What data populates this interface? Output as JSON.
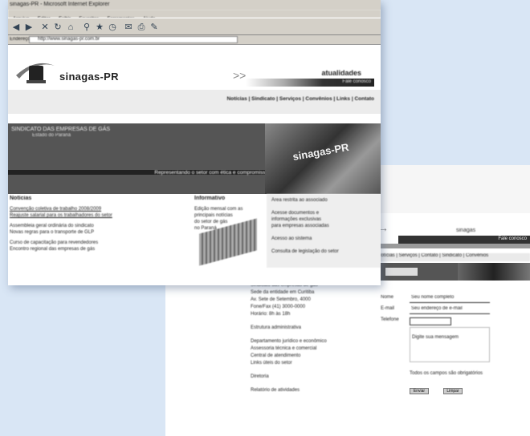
{
  "back": {
    "logo_text": "sinagas",
    "bar_text": "Fale conosco",
    "nav": "Notícias | Serviços | Contato | Sindicato | Convênios",
    "left_lines": [
      "Sindicato das empresas de gás",
      "Sede da entidade em Curitiba",
      "Av. Sete de Setembro, 4000",
      "Fone/Fax (41) 3000-0000",
      "Horário: 8h às 18h",
      "",
      "Estrutura administrativa",
      "",
      "Departamento jurídico e econômico",
      "Assessoria técnica e comercial",
      "Central de atendimento",
      "Links úteis do setor",
      "",
      "Diretoria",
      "",
      "Relatório de atividades"
    ],
    "form": {
      "name_label": "Nome",
      "name_value": "Seu nome completo",
      "email_label": "E-mail",
      "email_value": "Seu endereço de e-mail",
      "phone_label": "Telefone",
      "msg_value": "Digite sua mensagem",
      "submit": "Enviar",
      "clear": "Limpar",
      "note": "Todos os campos são obrigatórios"
    }
  },
  "front": {
    "window_title": "sinagas-PR - Microsoft Internet Explorer",
    "menu": [
      "Arquivo",
      "Editar",
      "Exibir",
      "Favoritos",
      "Ferramentas",
      "Ajuda"
    ],
    "address_label": "Endereço",
    "address_value": "http://www.sinagas-pr.com.br",
    "logo_text": "sinagas-PR",
    "header_title": "atualidades",
    "header_bar": "Fale conosco",
    "nav_links": "Notícias | Sindicato | Serviços | Convênios | Links | Contato",
    "banner_l1": "SINDICATO DAS EMPRESAS DE GÁS",
    "banner_l2": "Estado do Paraná",
    "banner_tagline": "Representando o setor com ética e compromisso",
    "banner_sign": "sinagas-PR",
    "news_title": "Notícias",
    "news": [
      "Convenção coletiva de trabalho 2008/2009",
      "Reajuste salarial para os trabalhadores do setor",
      "",
      "Assembleia geral ordinária do sindicato",
      "Novas regras para o transporte de GLP",
      "",
      "Curso de capacitação para revendedores",
      "Encontro regional das empresas de gás"
    ],
    "info_title": "Informativo",
    "info_lines": [
      "Edição mensal com as",
      "principais notícias",
      "do setor de gás",
      "no Paraná"
    ],
    "side": [
      "Área restrita ao associado",
      "",
      "Acesse documentos e",
      "informações exclusivas",
      "para empresas associadas",
      "",
      "Acesso ao sistema",
      "",
      "Consulta de legislação do setor"
    ]
  }
}
